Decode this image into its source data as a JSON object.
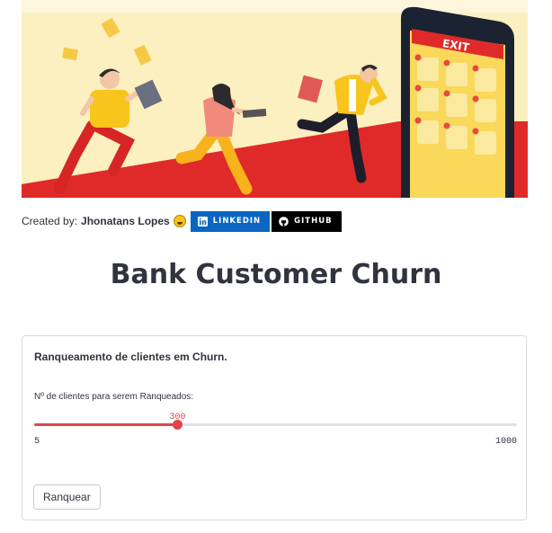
{
  "banner": {
    "image": "people-running-to-exit-illustration",
    "exit_sign": "EXIT"
  },
  "credits": {
    "prefix": "Created by:",
    "author": "Jhonatans Lopes",
    "emoji": "grinning-face-emoji",
    "linkedin_label": "LINKEDIN",
    "github_label": "GITHUB",
    "colors": {
      "linkedin": "#0a66c2",
      "github": "#000000"
    }
  },
  "page": {
    "title": "Bank Customer Churn"
  },
  "card": {
    "heading": "Ranqueamento de clientes em Churn.",
    "slider": {
      "label": "Nº de clientes para serem Ranqueados:",
      "value": 300,
      "min": 5,
      "max": 1000
    },
    "button_label": "Ranquear"
  },
  "colors": {
    "accent": "#e0454c",
    "text": "#31333f"
  }
}
